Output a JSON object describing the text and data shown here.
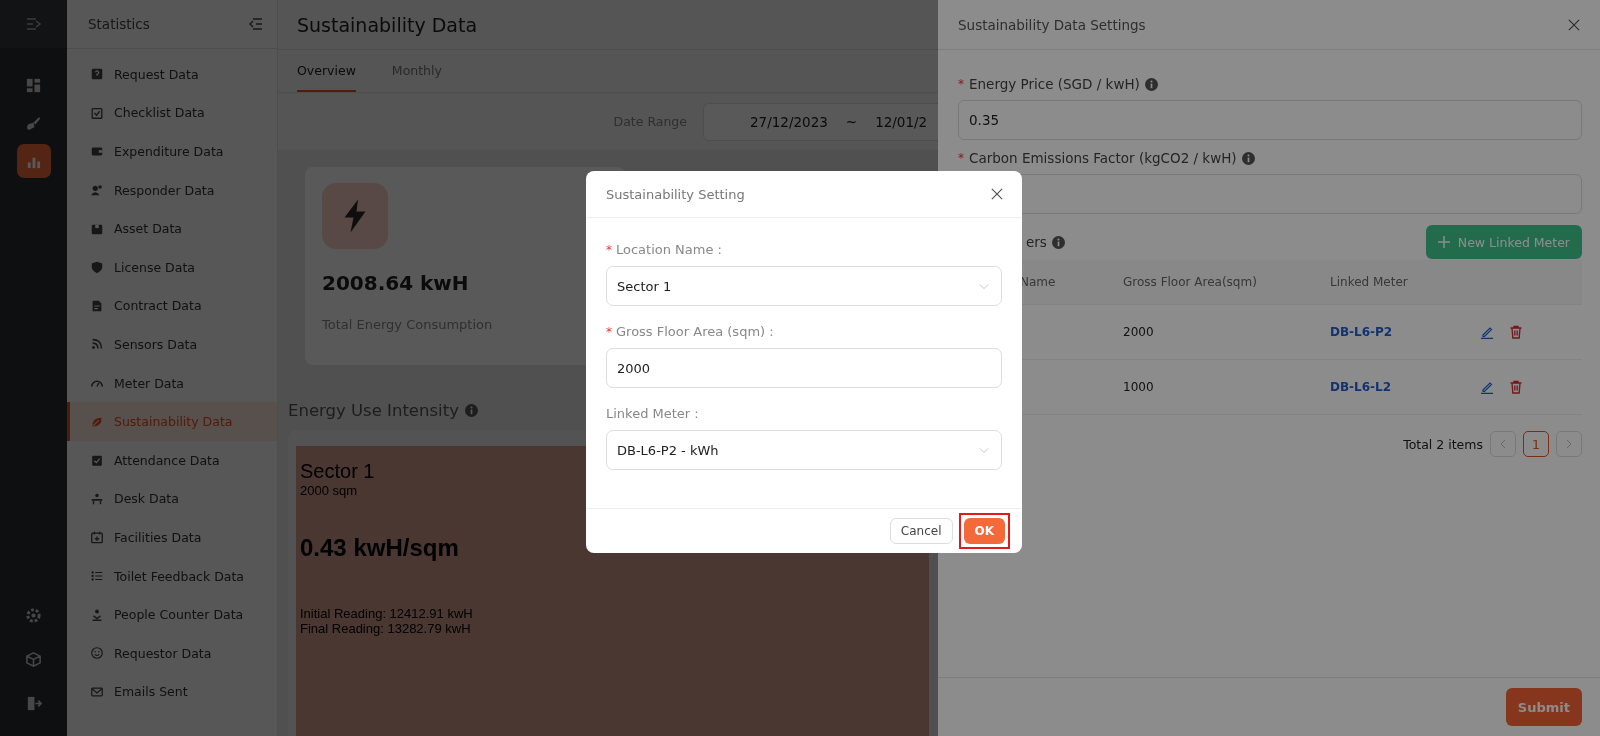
{
  "rail_items": [
    {
      "selected": false
    },
    {
      "selected": false
    },
    {
      "selected": true
    }
  ],
  "sidebar": {
    "title": "Statistics",
    "items": [
      {
        "label": "Request Data",
        "selected": false
      },
      {
        "label": "Checklist Data",
        "selected": false
      },
      {
        "label": "Expenditure Data",
        "selected": false
      },
      {
        "label": "Responder Data",
        "selected": false
      },
      {
        "label": "Asset Data",
        "selected": false
      },
      {
        "label": "License Data",
        "selected": false
      },
      {
        "label": "Contract Data",
        "selected": false
      },
      {
        "label": "Sensors Data",
        "selected": false
      },
      {
        "label": "Meter Data",
        "selected": false
      },
      {
        "label": "Sustainability Data",
        "selected": true
      },
      {
        "label": "Attendance Data",
        "selected": false
      },
      {
        "label": "Desk Data",
        "selected": false
      },
      {
        "label": "Facilities Data",
        "selected": false
      },
      {
        "label": "Toilet Feedback Data",
        "selected": false
      },
      {
        "label": "People Counter Data",
        "selected": false
      },
      {
        "label": "Requestor Data",
        "selected": false
      },
      {
        "label": "Emails Sent",
        "selected": false
      }
    ]
  },
  "page": {
    "title": "Sustainability Data",
    "tabs": [
      {
        "label": "Overview",
        "selected": true
      },
      {
        "label": "Monthly",
        "selected": false
      }
    ],
    "date_range": {
      "label": "Date Range",
      "start": "27/12/2023",
      "separator": "~",
      "end": "12/01/2"
    }
  },
  "summary_card": {
    "value": "2008.64 kwH",
    "label": "Total Energy Consumption"
  },
  "intensity": {
    "title": "Energy Use Intensity",
    "tile": {
      "name": "Sector 1",
      "area": "2000 sqm",
      "value": "0.43 kwH/sqm",
      "initial": "Initial Reading: 12412.91 kwH",
      "final": "Final Reading: 13282.79 kwH"
    }
  },
  "drawer": {
    "title": "Sustainability Data Settings",
    "fields": [
      {
        "label": "Energy Price (SGD / kwH)",
        "mark": "*",
        "value": "0.35"
      },
      {
        "label": "Carbon Emissions Factor (kgCO2 / kwH)",
        "mark": "*"
      }
    ],
    "meters_label": "ers",
    "new_button": "New Linked Meter",
    "columns": [
      "Name",
      "Gross Floor Area(sqm)",
      "Linked Meter"
    ],
    "rows": [
      {
        "area": "2000",
        "meter": "DB-L6-P2"
      },
      {
        "area": "1000",
        "meter": "DB-L6-L2"
      }
    ],
    "pagination": {
      "total": "Total 2 items",
      "pages": [
        {
          "label": "1",
          "selected": true
        }
      ]
    },
    "submit": "Submit"
  },
  "modal": {
    "title": "Sustainability Setting",
    "fields": [
      {
        "kind": "select",
        "label": "Location Name :",
        "mark": "*",
        "value": "Sector 1"
      },
      {
        "kind": "input",
        "label": "Gross Floor Area (sqm) :",
        "mark": "*",
        "value": "2000"
      },
      {
        "kind": "select",
        "label": "Linked Meter :",
        "value": "DB-L6-P2 - kWh"
      }
    ],
    "cancel": "Cancel",
    "ok": "OK",
    "ok_highlighted": true
  }
}
